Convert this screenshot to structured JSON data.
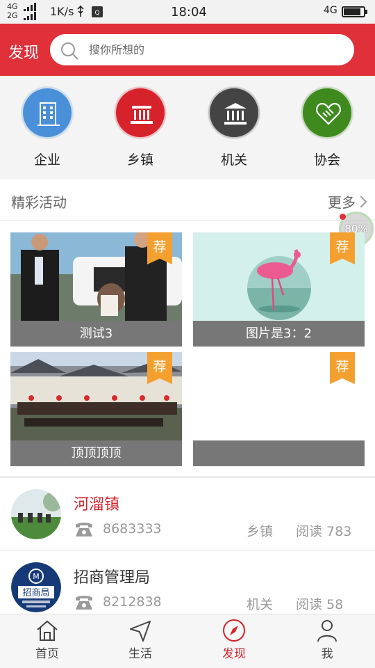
{
  "status": {
    "net_top": "4G",
    "net_bottom": "2G",
    "speed": "1K/s",
    "time": "18:04",
    "net_right": "4G"
  },
  "header": {
    "title": "发现",
    "search_placeholder": "搜你所想的"
  },
  "categories": [
    {
      "label": "企业",
      "color": "#4a90d9",
      "icon": "building-icon"
    },
    {
      "label": "乡镇",
      "color": "#d5222b",
      "icon": "town-hall-icon"
    },
    {
      "label": "机关",
      "color": "#444444",
      "icon": "government-icon"
    },
    {
      "label": "协会",
      "color": "#3f8a1f",
      "icon": "handshake-heart-icon"
    }
  ],
  "section": {
    "title": "精彩活动",
    "more": "更多"
  },
  "floatball": {
    "text": "80%"
  },
  "activities": [
    {
      "caption": "测试3",
      "badge": "荐"
    },
    {
      "caption": "图片是3：2",
      "badge": "荐"
    },
    {
      "caption": "顶顶顶顶",
      "badge": "荐"
    },
    {
      "caption": "",
      "badge": "荐"
    }
  ],
  "list": [
    {
      "name": "河溜镇",
      "name_color": "#d5222b",
      "phone": "8683333",
      "type": "乡镇",
      "reads": "阅读 783"
    },
    {
      "name": "招商管理局",
      "name_color": "#333333",
      "phone": "8212838",
      "type": "机关",
      "reads": "阅读 58"
    }
  ],
  "nav": [
    {
      "label": "首页",
      "icon": "home-icon"
    },
    {
      "label": "生活",
      "icon": "navigation-arrow-icon"
    },
    {
      "label": "发现",
      "icon": "compass-icon",
      "active": true
    },
    {
      "label": "我",
      "icon": "person-icon"
    }
  ]
}
